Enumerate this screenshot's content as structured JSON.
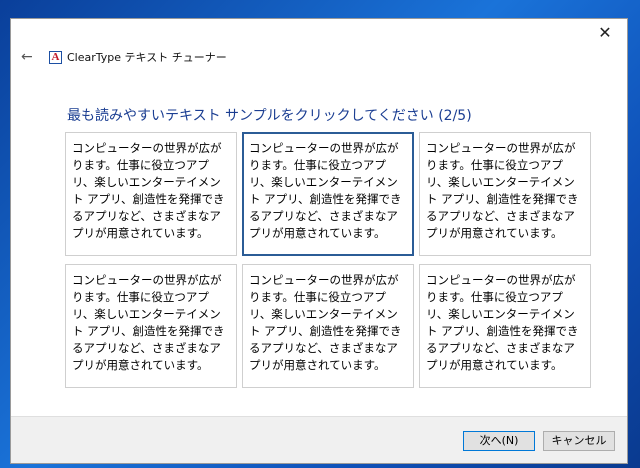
{
  "window": {
    "title": "ClearType テキスト チューナー",
    "close_glyph": "✕",
    "back_glyph": "←",
    "app_icon_letter": "A"
  },
  "main": {
    "instruction": "最も読みやすいテキスト サンプルをクリックしてください (2/5)",
    "samples": [
      {
        "text": "コンピューターの世界が広がります。仕事に役立つアプリ、楽しいエンターテイメント アプリ、創造性を発揮できるアプリなど、さまざまなアプリが用意されています。",
        "selected": false
      },
      {
        "text": "コンピューターの世界が広がります。仕事に役立つアプリ、楽しいエンターテイメント アプリ、創造性を発揮できるアプリなど、さまざまなアプリが用意されています。",
        "selected": true
      },
      {
        "text": "コンピューターの世界が広がります。仕事に役立つアプリ、楽しいエンターテイメント アプリ、創造性を発揮できるアプリなど、さまざまなアプリが用意されています。",
        "selected": false
      },
      {
        "text": "コンピューターの世界が広がります。仕事に役立つアプリ、楽しいエンターテイメント アプリ、創造性を発揮できるアプリなど、さまざまなアプリが用意されています。",
        "selected": false
      },
      {
        "text": "コンピューターの世界が広がります。仕事に役立つアプリ、楽しいエンターテイメント アプリ、創造性を発揮できるアプリなど、さまざまなアプリが用意されています。",
        "selected": false
      },
      {
        "text": "コンピューターの世界が広がります。仕事に役立つアプリ、楽しいエンターテイメント アプリ、創造性を発揮できるアプリなど、さまざまなアプリが用意されています。",
        "selected": false
      }
    ]
  },
  "footer": {
    "next_label": "次へ(N)",
    "cancel_label": "キャンセル"
  },
  "colors": {
    "accent": "#0078d7",
    "instruction_text": "#1b3e92",
    "selected_border": "#2b5c96"
  }
}
